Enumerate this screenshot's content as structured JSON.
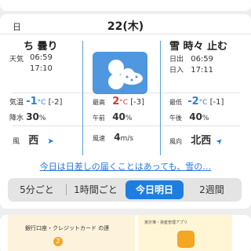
{
  "header": {
    "day_col": "日",
    "date": "22(木)"
  },
  "left": {
    "condition": "ち 曇り",
    "weather_label": "天気",
    "time1": "06:59",
    "time2": "17:10",
    "temp_label": "気温",
    "temp_val": "-1",
    "temp_unit": "°C",
    "temp_diff": "[-2]",
    "precip_label": "降水",
    "precip_val": "30",
    "precip_unit": "%",
    "wind_label": "風",
    "wind_dir": "西"
  },
  "middle": {
    "max_label": "最高",
    "max_val": "2",
    "max_unit": "°C",
    "max_diff": "[-3]",
    "am_label": "午前",
    "am_val": "40",
    "pct": "%",
    "wind_speed_label": "風速",
    "wind_speed_val": "4",
    "wind_speed_unit": "m/s"
  },
  "right": {
    "condition": "雪 時々 止む",
    "sunrise_label": "日出",
    "sunrise": "06:59",
    "sunset_label": "日入",
    "sunset": "17:11",
    "min_label": "最低",
    "min_val": "-2",
    "min_unit": "°C",
    "min_diff": "[-1]",
    "pm_label": "午後",
    "pm_val": "40",
    "pct": "%",
    "wind_dir_label": "風向",
    "wind_dir": "北西"
  },
  "link_text": "今日は日差しの届くことはあっても、雪の…",
  "tabs": [
    "5分ごと",
    "1時間ごと",
    "今日明日",
    "2週間"
  ],
  "active_tab": "今日明日",
  "ad": {
    "left_text": "銀行口座・クレジットカード の連",
    "step": "2",
    "right_text": "家計簿・資産管理アプリ"
  },
  "colors": {
    "accent": "#1d7ee0",
    "hot": "#e03030",
    "cold": "#2b7de0"
  }
}
